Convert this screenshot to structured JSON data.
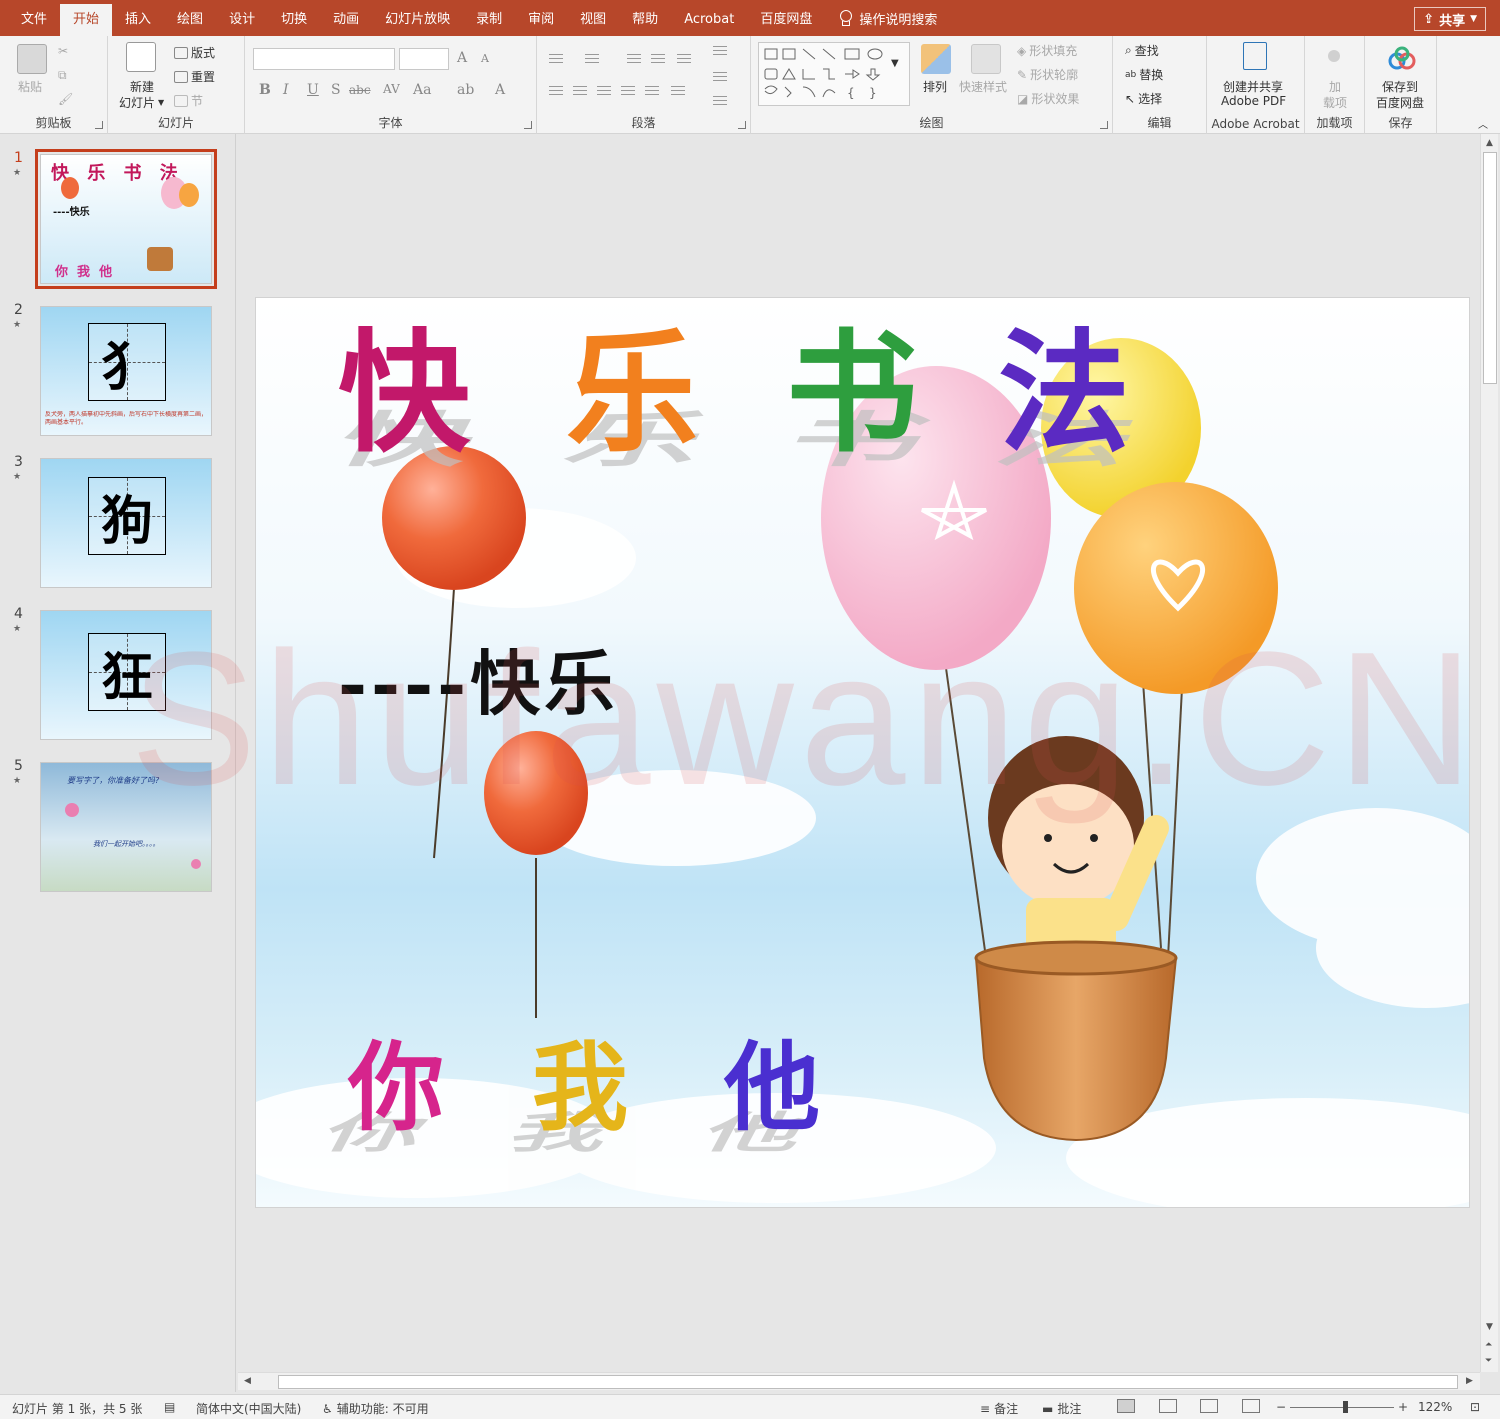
{
  "tabs": [
    "文件",
    "开始",
    "插入",
    "绘图",
    "设计",
    "切换",
    "动画",
    "幻灯片放映",
    "录制",
    "审阅",
    "视图",
    "帮助",
    "Acrobat",
    "百度网盘"
  ],
  "active_tab": "开始",
  "tell_me": "操作说明搜索",
  "share": "共享",
  "ribbon": {
    "clipboard": {
      "label": "剪贴板",
      "paste": "粘贴"
    },
    "slides": {
      "label": "幻灯片",
      "new_slide_1": "新建",
      "new_slide_2": "幻灯片",
      "layout": "版式",
      "reset": "重置",
      "section": "节"
    },
    "font": {
      "label": "字体",
      "bold": "B",
      "italic": "I",
      "underline": "U",
      "shadow": "S",
      "strike": "abc",
      "spacing": "AV",
      "case": "Aa",
      "grow": "A",
      "shrink": "A"
    },
    "paragraph": {
      "label": "段落"
    },
    "drawing": {
      "label": "绘图",
      "arrange": "排列",
      "quick_styles": "快速样式",
      "shape_fill": "形状填充",
      "shape_outline": "形状轮廓",
      "shape_effects": "形状效果"
    },
    "editing": {
      "label": "编辑",
      "find": "查找",
      "replace": "替换",
      "select": "选择"
    },
    "acrobat": {
      "label": "Adobe Acrobat",
      "create_1": "创建并共享",
      "create_2": "Adobe PDF"
    },
    "addins": {
      "label": "加载项",
      "btn_1": "加",
      "btn_2": "载项"
    },
    "save": {
      "label": "保存",
      "btn_1": "保存到",
      "btn_2": "百度网盘"
    }
  },
  "thumbnails": [
    {
      "num": "1",
      "title": "快 乐 书 法",
      "sub": "----快乐",
      "bottom": "你  我  他"
    },
    {
      "num": "2",
      "char": "犭",
      "caption": "反犬旁，两人描摹初中先斜画，后写右中下长横度再第二画，两画基本平行。"
    },
    {
      "num": "3",
      "char": "狗"
    },
    {
      "num": "4",
      "char": "狂"
    },
    {
      "num": "5",
      "line1": "要写字了，你准备好了吗?",
      "line2": "我们一起开始吧。。。。"
    }
  ],
  "slide": {
    "title_chars": [
      "快",
      "乐",
      "书",
      "法"
    ],
    "subtitle": "----快乐",
    "bottom_chars": [
      "你",
      "我",
      "他"
    ],
    "watermark": "Shufawang.CN"
  },
  "status": {
    "slide_info": "幻灯片 第 1 张，共 5 张",
    "language": "简体中文(中国大陆)",
    "accessibility": "辅助功能: 不可用",
    "notes": "备注",
    "comments": "批注",
    "zoom": "122%"
  },
  "colors": {
    "accent": "#b7472a",
    "ribbon_bg": "#f3f3f3",
    "selection": "#c43e1c"
  }
}
